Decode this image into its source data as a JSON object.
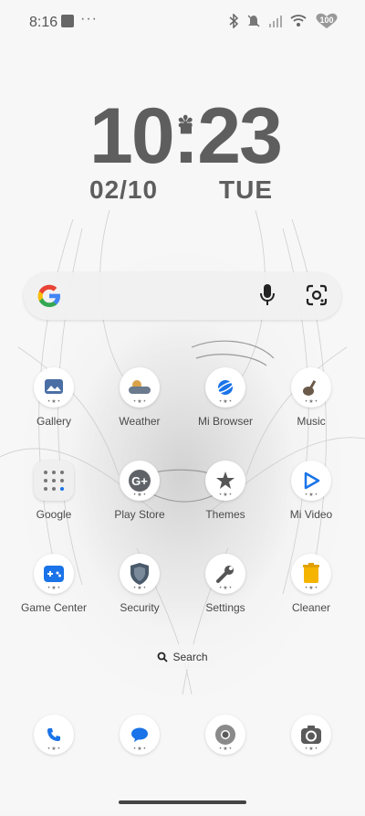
{
  "status_bar": {
    "time": "8:16",
    "battery": "100",
    "icons": [
      "notification-square-icon",
      "more-dots-icon",
      "bluetooth-icon",
      "mute-icon",
      "signal-icon",
      "wifi-icon",
      "battery-icon"
    ]
  },
  "clock": {
    "time": "10:23",
    "date": "02/10",
    "day": "TUE"
  },
  "search_bar": {
    "icons": [
      "google-logo-icon",
      "microphone-icon",
      "google-lens-icon"
    ]
  },
  "apps": [
    {
      "label": "Gallery",
      "icon": "gallery-icon"
    },
    {
      "label": "Weather",
      "icon": "weather-icon"
    },
    {
      "label": "Mi Browser",
      "icon": "browser-icon"
    },
    {
      "label": "Music",
      "icon": "music-icon"
    },
    {
      "label": "Google",
      "icon": "google-folder-icon"
    },
    {
      "label": "Play Store",
      "icon": "play-store-icon"
    },
    {
      "label": "Themes",
      "icon": "themes-icon"
    },
    {
      "label": "Mi Video",
      "icon": "video-icon"
    },
    {
      "label": "Game Center",
      "icon": "game-center-icon"
    },
    {
      "label": "Security",
      "icon": "security-icon"
    },
    {
      "label": "Settings",
      "icon": "settings-icon"
    },
    {
      "label": "Cleaner",
      "icon": "cleaner-icon"
    }
  ],
  "search_pill": {
    "label": "Search"
  },
  "dock": [
    {
      "icon": "phone-icon"
    },
    {
      "icon": "messages-icon"
    },
    {
      "icon": "chrome-icon"
    },
    {
      "icon": "camera-icon"
    }
  ],
  "colors": {
    "accent_blue": "#1a73e8",
    "clock_gray": "#5e5e5e"
  }
}
